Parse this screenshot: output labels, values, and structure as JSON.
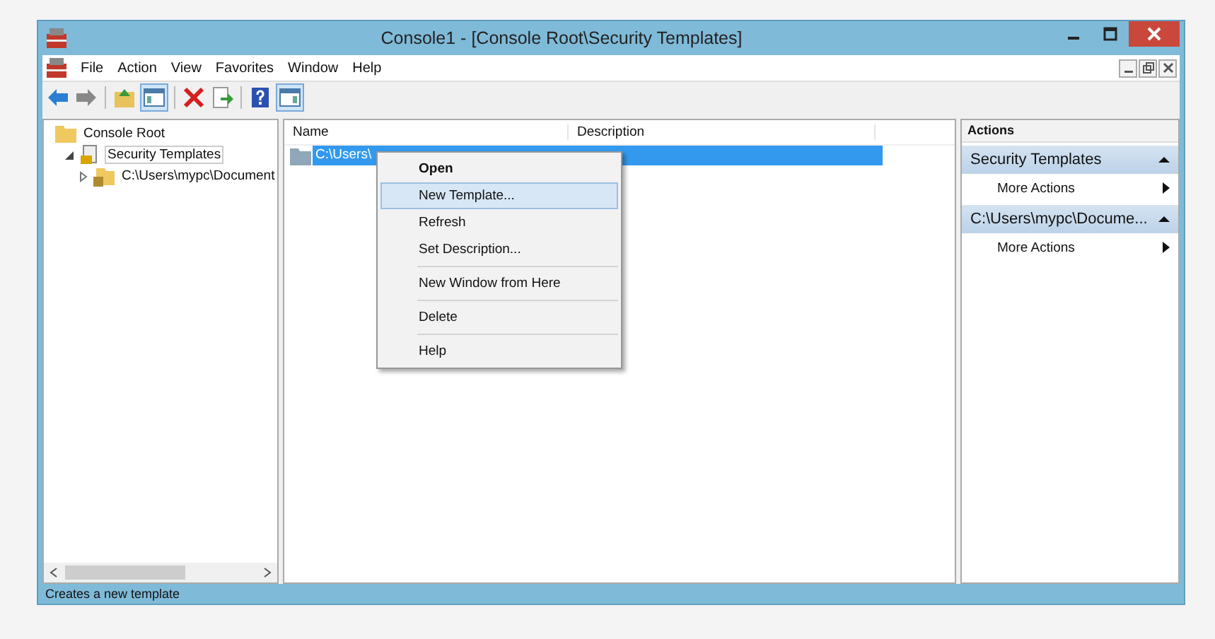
{
  "window": {
    "title": "Console1 - [Console Root\\Security Templates]"
  },
  "menu": [
    "File",
    "Action",
    "View",
    "Favorites",
    "Window",
    "Help"
  ],
  "tree": [
    {
      "label": "Console Root",
      "expanded": true,
      "selected": false,
      "children": [
        {
          "label": "Security Templates",
          "expanded": true,
          "selected": true,
          "children": [
            {
              "label": "C:\\Users\\mypc\\Document",
              "expanded": false,
              "selected": false
            }
          ]
        }
      ]
    }
  ],
  "table": {
    "columns": [
      "Name",
      "Description"
    ],
    "rows": [
      {
        "name": "C:\\Users\\",
        "selected": true
      }
    ]
  },
  "context_menu": [
    {
      "kind": "item",
      "label": "Open",
      "bold": true,
      "selected": false
    },
    {
      "kind": "item",
      "label": "New Template...",
      "bold": false,
      "selected": true
    },
    {
      "kind": "item",
      "label": "Refresh",
      "bold": false,
      "selected": false
    },
    {
      "kind": "item",
      "label": "Set Description...",
      "bold": false,
      "selected": false
    },
    {
      "kind": "separator"
    },
    {
      "kind": "item",
      "label": "New Window from Here",
      "bold": false,
      "selected": false
    },
    {
      "kind": "separator"
    },
    {
      "kind": "item",
      "label": "Delete",
      "bold": false,
      "selected": false
    },
    {
      "kind": "separator"
    },
    {
      "kind": "item",
      "label": "Help",
      "bold": false,
      "selected": false
    }
  ],
  "actions": {
    "title": "Actions",
    "sections": [
      {
        "title": "Security Templates",
        "items": [
          "More Actions"
        ]
      },
      {
        "title": "C:\\Users\\mypc\\Docume...",
        "items": [
          "More Actions"
        ]
      }
    ]
  },
  "status_bar": "Creates a new template"
}
